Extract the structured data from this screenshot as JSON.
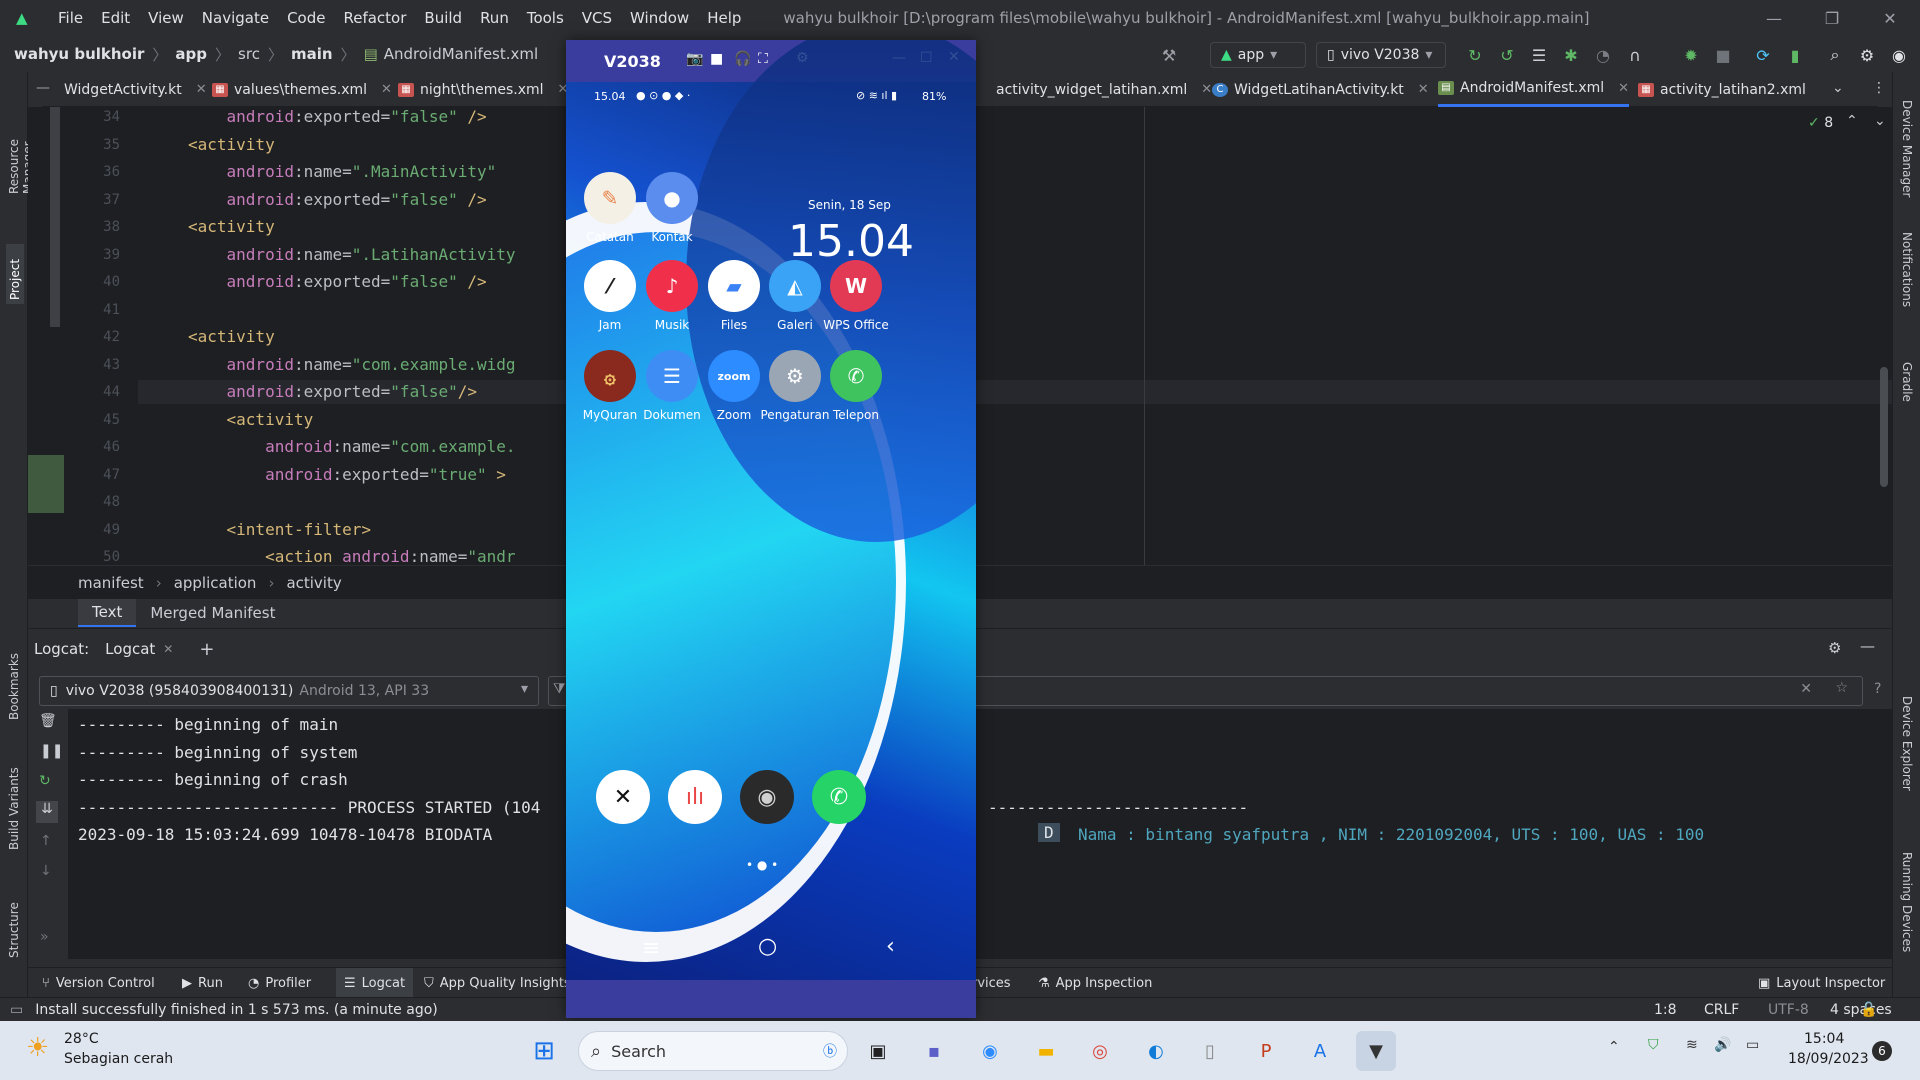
{
  "menubar": {
    "items": [
      "File",
      "Edit",
      "View",
      "Navigate",
      "Code",
      "Refactor",
      "Build",
      "Run",
      "Tools",
      "VCS",
      "Window",
      "Help"
    ],
    "window_title": "wahyu bulkhoir [D:\\program files\\mobile\\wahyu bulkhoir] - AndroidManifest.xml [wahyu_bulkhoir.app.main]"
  },
  "navbar": {
    "breadcrumb": [
      "wahyu bulkhoir",
      "app",
      "src",
      "main",
      "AndroidManifest.xml"
    ],
    "run_config": "app",
    "device": "vivo V2038"
  },
  "tabs": [
    {
      "label": "WidgetActivity.kt"
    },
    {
      "label": "values\\themes.xml"
    },
    {
      "label": "night\\themes.xml"
    },
    {
      "label": "activity_widget_latihan.xml"
    },
    {
      "label": "WidgetLatihanActivity.kt"
    },
    {
      "label": "AndroidManifest.xml"
    },
    {
      "label": "activity_latihan2.xml"
    }
  ],
  "editor": {
    "inspection_count": "8",
    "line_numbers": [
      "34",
      "35",
      "36",
      "37",
      "38",
      "39",
      "40",
      "41",
      "42",
      "43",
      "44",
      "45",
      "46",
      "47",
      "48",
      "49",
      "50"
    ],
    "lines": [
      {
        "attr": "android",
        "key": ":exported=",
        "val": "\"false\"",
        "end": " />",
        "indent": "    "
      },
      {
        "tag": "<activity",
        "indent": ""
      },
      {
        "attr": "android",
        "key": ":name=",
        "val": "\".MainActivity\"",
        "end": "",
        "indent": "    "
      },
      {
        "attr": "android",
        "key": ":exported=",
        "val": "\"false\"",
        "end": " />",
        "indent": "    "
      },
      {
        "tag": "<activity",
        "indent": ""
      },
      {
        "attr": "android",
        "key": ":name=",
        "val": "\".LatihanActivity",
        "end": "",
        "indent": "    "
      },
      {
        "attr": "android",
        "key": ":exported=",
        "val": "\"false\"",
        "end": " />",
        "indent": "    "
      },
      {
        "tag": "",
        "indent": ""
      },
      {
        "tag": "<activity",
        "indent": ""
      },
      {
        "attr": "android",
        "key": ":name=",
        "val": "\"com.example.widg",
        "end": "",
        "indent": "    "
      },
      {
        "attr": "android",
        "key": ":exported=",
        "val": "\"false\"",
        "end": "/>",
        "indent": "    "
      },
      {
        "tag": "<activity",
        "indent": "    "
      },
      {
        "attr": "android",
        "key": ":name=",
        "val": "\"com.example.",
        "end": "",
        "indent": "        "
      },
      {
        "attr": "android",
        "key": ":exported=",
        "val": "\"true\"",
        "end": " >",
        "indent": "        "
      },
      {
        "tag": "",
        "indent": ""
      },
      {
        "tag": "<intent-filter>",
        "indent": "    "
      },
      {
        "tag": "<action ",
        "attr": "android",
        "key": ":name=",
        "val": "\"andr",
        "indent": "        "
      }
    ],
    "breadcrumb": [
      "manifest",
      "application",
      "activity"
    ],
    "bottom_tabs": [
      "Text",
      "Merged Manifest"
    ]
  },
  "logcat": {
    "label": "Logcat:",
    "tab": "Logcat",
    "device": "vivo V2038 (958403908400131)",
    "device_meta": "Android 13, API 33",
    "lines": [
      "--------- beginning of main",
      "--------- beginning of system",
      "--------- beginning of crash",
      "--------------------------- PROCESS STARTED (104",
      "2023-09-18 15:03:24.699 10478-10478 BIODATA"
    ],
    "right_dashes": "---------------------------",
    "level": "D",
    "message": "Nama : bintang syafputra , NIM : 2201092004, UTS : 100, UAS : 100"
  },
  "tool_windows": [
    "Version Control",
    "Run",
    "Profiler",
    "Logcat",
    "App Quality Insights",
    "rvices",
    "App Inspection",
    "Layout Inspector"
  ],
  "left_tools": [
    "Resource Manager",
    "Project",
    "Bookmarks",
    "Build Variants",
    "Structure"
  ],
  "right_tools": [
    "Device Manager",
    "Notifications",
    "Gradle",
    "Device Explorer",
    "Running Devices"
  ],
  "status": {
    "message": "Install successfully finished in 1 s 573 ms. (a minute ago)",
    "position": "1:8",
    "line_sep": "CRLF",
    "encoding": "UTF-8",
    "indent": "4 spaces"
  },
  "phone": {
    "title": "V2038",
    "status_time": "15.04",
    "battery": "81%",
    "date": "Senin, 18 Sep",
    "clock": "15.04",
    "apps": [
      {
        "label": "Catatan",
        "color": "#f4f0e6",
        "glyph": "✎",
        "fg": "#e8834a"
      },
      {
        "label": "Kontak",
        "color": "#5b8def",
        "glyph": "●",
        "fg": "#ffffff"
      },
      {
        "label": "Jam",
        "color": "#ffffff",
        "glyph": "⁄",
        "fg": "#222222"
      },
      {
        "label": "Musik",
        "color": "#f0304a",
        "glyph": "♪",
        "fg": "#ffffff"
      },
      {
        "label": "Files",
        "color": "#ffffff",
        "glyph": "▰",
        "fg": "#3b82f6"
      },
      {
        "label": "Galeri",
        "color": "#3aa3f5",
        "glyph": "◭",
        "fg": "#ffffff"
      },
      {
        "label": "WPS Office",
        "color": "#e23a55",
        "glyph": "W",
        "fg": "#ffffff"
      },
      {
        "label": "MyQuran",
        "color": "#8a2a1e",
        "glyph": "۞",
        "fg": "#f3c56a"
      },
      {
        "label": "Dokumen",
        "color": "#3e8df5",
        "glyph": "☰",
        "fg": "#ffffff"
      },
      {
        "label": "Zoom",
        "color": "#2d8cff",
        "glyph": "zoom",
        "fg": "#ffffff"
      },
      {
        "label": "Pengaturan",
        "color": "#9aa6b4",
        "glyph": "⚙",
        "fg": "#ffffff"
      },
      {
        "label": "Telepon",
        "color": "#3fc35f",
        "glyph": "✆",
        "fg": "#ffffff"
      }
    ],
    "dock": [
      {
        "name": "capcut",
        "color": "#ffffff",
        "glyph": "✕",
        "fg": "#111111"
      },
      {
        "name": "recorder",
        "color": "#ffffff",
        "glyph": "ılı",
        "fg": "#e94646"
      },
      {
        "name": "camera",
        "color": "#2a2a2a",
        "glyph": "◉",
        "fg": "#cfcfcf"
      },
      {
        "name": "whatsapp",
        "color": "#25d366",
        "glyph": "✆",
        "fg": "#ffffff"
      }
    ]
  },
  "taskbar": {
    "temp": "28°C",
    "weather": "Sebagian cerah",
    "search": "Search",
    "time": "15:04",
    "date": "18/09/2023",
    "badge": "6"
  }
}
